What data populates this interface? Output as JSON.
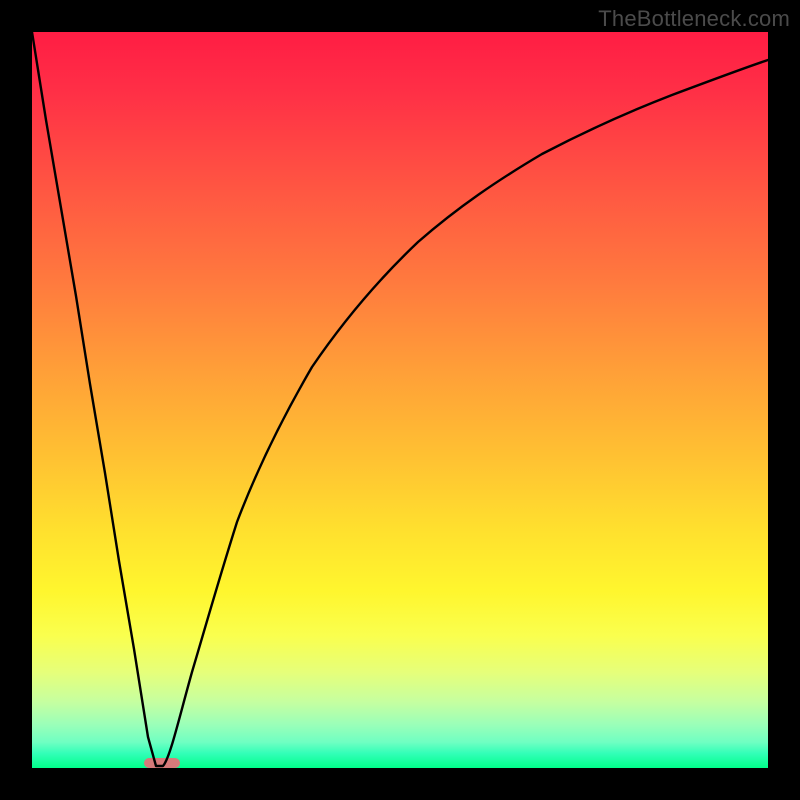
{
  "watermark": "TheBottleneck.com",
  "chart_data": {
    "type": "line",
    "title": "",
    "xlabel": "",
    "ylabel": "",
    "xlim": [
      0,
      100
    ],
    "ylim": [
      0,
      100
    ],
    "grid": false,
    "gradient_stops": [
      {
        "pos": 0,
        "color": "#ff1d44"
      },
      {
        "pos": 22,
        "color": "#ff5842"
      },
      {
        "pos": 46,
        "color": "#ff9f38"
      },
      {
        "pos": 68,
        "color": "#ffe12e"
      },
      {
        "pos": 82,
        "color": "#faff4e"
      },
      {
        "pos": 94,
        "color": "#9cffb8"
      },
      {
        "pos": 100,
        "color": "#00ff8a"
      }
    ],
    "series": [
      {
        "name": "bottleneck-curve",
        "x": [
          0,
          2,
          4,
          6,
          8,
          10,
          12,
          14,
          16,
          17,
          18,
          20,
          22,
          24,
          26,
          28,
          30,
          34,
          38,
          42,
          46,
          50,
          55,
          60,
          65,
          70,
          75,
          80,
          85,
          90,
          95,
          100
        ],
        "y": [
          100,
          88,
          76,
          64,
          52,
          40,
          28,
          16,
          4,
          0,
          0,
          6,
          13,
          20,
          27,
          33,
          39,
          49,
          57,
          64,
          70,
          75,
          80,
          84,
          87,
          90,
          92,
          93.5,
          95,
          96,
          97,
          97.5
        ]
      }
    ],
    "marker": {
      "name": "minimum-marker",
      "x_center": 17.5,
      "width": 4,
      "color": "#d67a7a"
    }
  }
}
